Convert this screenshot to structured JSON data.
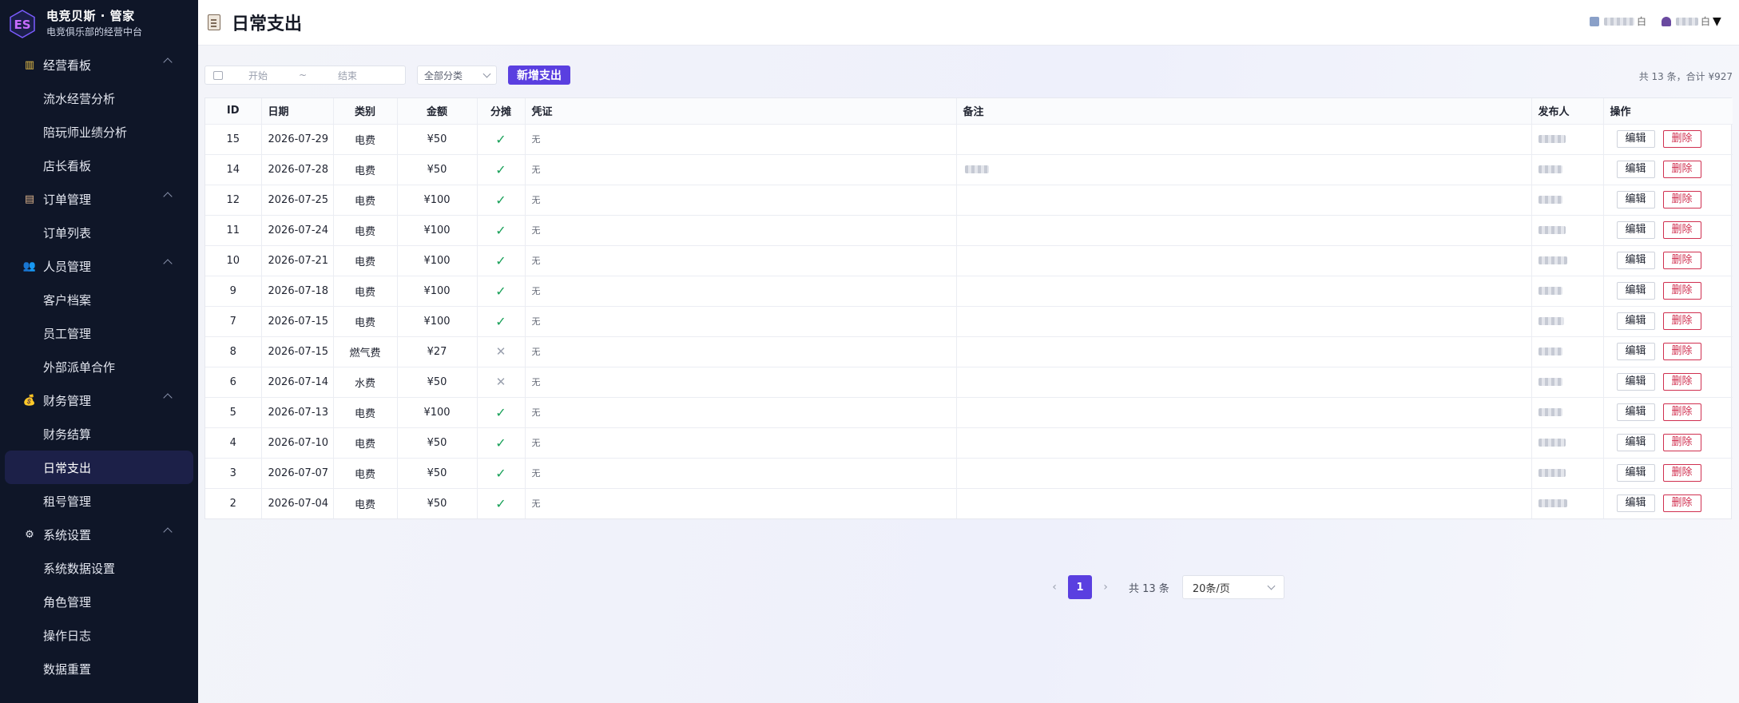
{
  "brand": {
    "title": "电竞贝斯 · 管家",
    "subtitle": "电竞俱乐部的经营中台",
    "logo_text": "ES"
  },
  "sidebar": {
    "groups": [
      {
        "label": "经营看板",
        "icon": "chart-icon",
        "items": [
          "流水经营分析",
          "陪玩师业绩分析",
          "店长看板"
        ]
      },
      {
        "label": "订单管理",
        "icon": "clipboard-icon",
        "items": [
          "订单列表"
        ]
      },
      {
        "label": "人员管理",
        "icon": "people-icon",
        "items": [
          "客户档案",
          "员工管理",
          "外部派单合作"
        ]
      },
      {
        "label": "财务管理",
        "icon": "money-bag-icon",
        "items": [
          "财务结算",
          "日常支出",
          "租号管理"
        ]
      },
      {
        "label": "系统设置",
        "icon": "gear-icon",
        "items": [
          "系统数据设置",
          "角色管理",
          "操作日志",
          "数据重置"
        ]
      }
    ],
    "active_item": "日常支出"
  },
  "header": {
    "title": "日常支出",
    "user_suffix_1": "白",
    "user_suffix_2": "白"
  },
  "toolbar": {
    "start_placeholder": "开始",
    "range_separator": "~",
    "end_placeholder": "结束",
    "category_value": "全部分类",
    "add_button": "新增支出"
  },
  "summary": "共 13 条，合计 ¥927",
  "table": {
    "columns": [
      "ID",
      "日期",
      "类别",
      "金额",
      "分摊",
      "凭证",
      "备注",
      "发布人",
      "操作"
    ],
    "edit_label": "编辑",
    "delete_label": "删除",
    "rows": [
      {
        "id": "15",
        "date": "2026-07-29",
        "category": "电费",
        "amount": "¥50",
        "shared": true,
        "voucher": "无"
      },
      {
        "id": "14",
        "date": "2026-07-28",
        "category": "电费",
        "amount": "¥50",
        "shared": true,
        "voucher": "无"
      },
      {
        "id": "12",
        "date": "2026-07-25",
        "category": "电费",
        "amount": "¥100",
        "shared": true,
        "voucher": "无"
      },
      {
        "id": "11",
        "date": "2026-07-24",
        "category": "电费",
        "amount": "¥100",
        "shared": true,
        "voucher": "无"
      },
      {
        "id": "10",
        "date": "2026-07-21",
        "category": "电费",
        "amount": "¥100",
        "shared": true,
        "voucher": "无"
      },
      {
        "id": "9",
        "date": "2026-07-18",
        "category": "电费",
        "amount": "¥100",
        "shared": true,
        "voucher": "无"
      },
      {
        "id": "7",
        "date": "2026-07-15",
        "category": "电费",
        "amount": "¥100",
        "shared": true,
        "voucher": "无"
      },
      {
        "id": "8",
        "date": "2026-07-15",
        "category": "燃气费",
        "amount": "¥27",
        "shared": false,
        "voucher": "无"
      },
      {
        "id": "6",
        "date": "2026-07-14",
        "category": "水费",
        "amount": "¥50",
        "shared": false,
        "voucher": "无"
      },
      {
        "id": "5",
        "date": "2026-07-13",
        "category": "电费",
        "amount": "¥100",
        "shared": true,
        "voucher": "无"
      },
      {
        "id": "4",
        "date": "2026-07-10",
        "category": "电费",
        "amount": "¥50",
        "shared": true,
        "voucher": "无"
      },
      {
        "id": "3",
        "date": "2026-07-07",
        "category": "电费",
        "amount": "¥50",
        "shared": true,
        "voucher": "无"
      },
      {
        "id": "2",
        "date": "2026-07-04",
        "category": "电费",
        "amount": "¥50",
        "shared": true,
        "voucher": "无"
      }
    ]
  },
  "pagination": {
    "current_page": "1",
    "total_text": "共 13 条",
    "page_size": "20条/页"
  },
  "colors": {
    "accent": "#5a3fe0",
    "sidebar_bg": "#0f1628",
    "danger": "#d03050",
    "success": "#18a058"
  }
}
